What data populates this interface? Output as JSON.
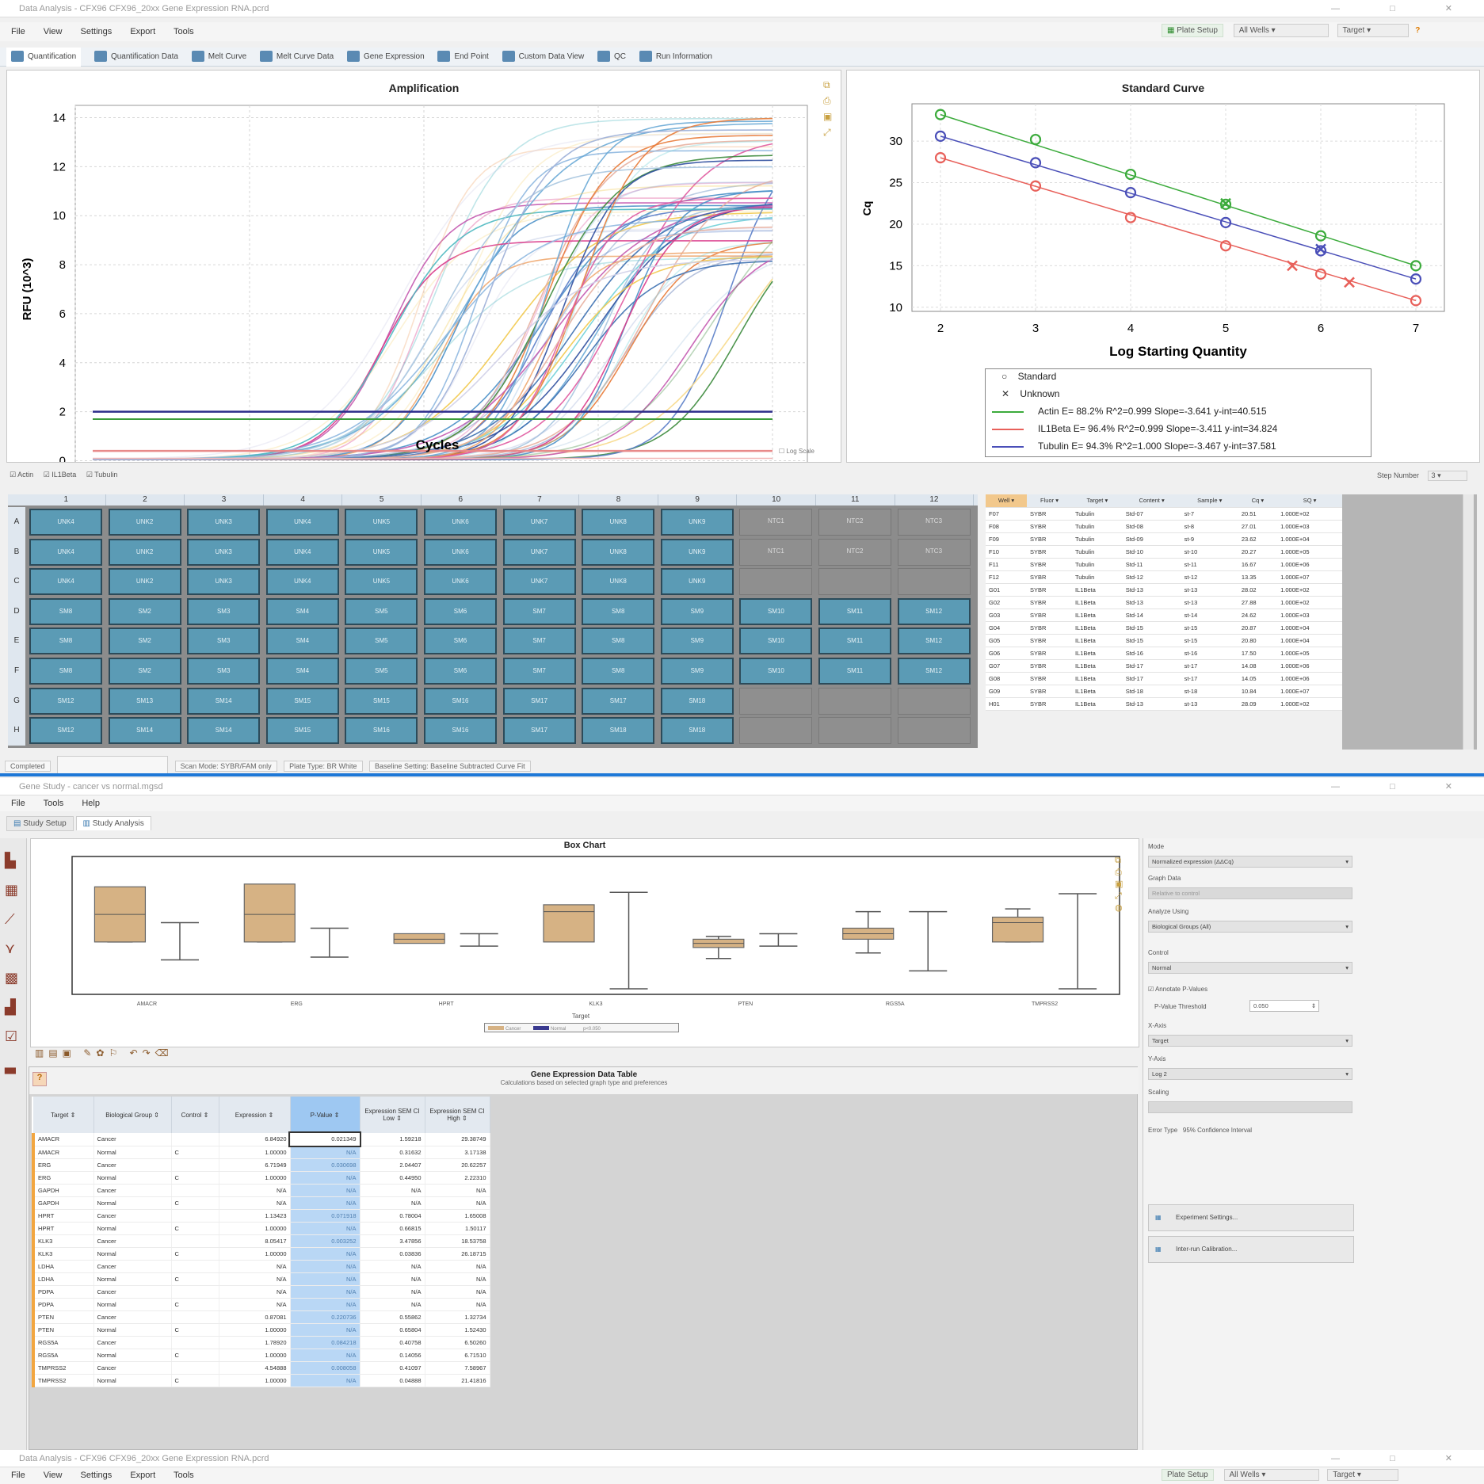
{
  "top_window": {
    "title": "Data Analysis - CFX96 CFX96_20xx Gene Expression RNA.pcrd",
    "menu": [
      "File",
      "View",
      "Settings",
      "Export",
      "Tools"
    ],
    "toolbar_right": {
      "plate_setup": "Plate Setup",
      "well_group": "All Wells",
      "select": "Target"
    },
    "tabs": [
      "Quantification",
      "Quantification Data",
      "Melt Curve",
      "Melt Curve Data",
      "Gene Expression",
      "End Point",
      "Custom Data View",
      "QC",
      "Run Information"
    ],
    "legend_checks": [
      "Actin",
      "IL1Beta",
      "Tubulin"
    ],
    "log_scale": "Log Scale",
    "step_number": "Step Number",
    "step_value": "3"
  },
  "amplification": {
    "title": "Amplification",
    "xlabel": "Cycles",
    "ylabel": "RFU (10^3)",
    "xticks": [
      "0",
      "10",
      "20",
      "30",
      "40"
    ],
    "yticks": [
      "0",
      "2",
      "4",
      "6",
      "8",
      "10",
      "12",
      "14"
    ]
  },
  "standard_curve": {
    "title": "Standard Curve",
    "xlabel": "Log Starting Quantity",
    "ylabel": "Cq",
    "xticks": [
      "2",
      "3",
      "4",
      "5",
      "6",
      "7"
    ],
    "yticks": [
      "10",
      "15",
      "20",
      "25",
      "30"
    ],
    "legend": {
      "standard": "Standard",
      "unknown": "Unknown",
      "actin": "Actin   E= 88.2% R^2=0.999 Slope=-3.641 y-int=40.515",
      "il1beta": "IL1Beta  E= 96.4% R^2=0.999 Slope=-3.411 y-int=34.824",
      "tubulin": "Tubulin  E= 94.3% R^2=1.000 Slope=-3.467 y-int=37.581"
    }
  },
  "chart_data": [
    {
      "type": "line",
      "title": "Amplification",
      "xlabel": "Cycles",
      "ylabel": "RFU (10^3)",
      "xlim": [
        0,
        42
      ],
      "ylim": [
        -0.5,
        14.5
      ],
      "series_summary": "sigmoidal amplification curves, Cq range 12-38, plateaus 8-14"
    },
    {
      "type": "scatter",
      "title": "Standard Curve",
      "xlabel": "Log Starting Quantity",
      "ylabel": "Cq",
      "xlim": [
        1.7,
        7.3
      ],
      "ylim": [
        9.5,
        34.5
      ],
      "series": [
        {
          "name": "Actin",
          "color": "#3cab3c",
          "x": [
            2,
            3,
            4,
            5,
            6,
            7
          ],
          "y": [
            33.2,
            30.2,
            26.0,
            22.4,
            18.6,
            15.0
          ],
          "unknowns": {
            "x": [
              5.0
            ],
            "y": [
              22.5
            ]
          }
        },
        {
          "name": "IL1Beta",
          "color": "#e8605a",
          "x": [
            2,
            3,
            4,
            5,
            6,
            7
          ],
          "y": [
            28.0,
            24.6,
            20.8,
            17.4,
            14.0,
            10.8
          ],
          "unknowns": {
            "x": [
              5.7,
              6.3
            ],
            "y": [
              15.0,
              13.0
            ]
          }
        },
        {
          "name": "Tubulin",
          "color": "#4a4fb8",
          "x": [
            2,
            3,
            4,
            5,
            6,
            7
          ],
          "y": [
            30.6,
            27.4,
            23.8,
            20.2,
            16.8,
            13.4
          ],
          "unknowns": {
            "x": [
              6.0
            ],
            "y": [
              17.0
            ]
          }
        }
      ]
    },
    {
      "type": "box",
      "title": "Box Chart",
      "xlabel": "Target",
      "categories": [
        "AMACR",
        "ERG",
        "HPRT",
        "KLK3",
        "PTEN",
        "RGS5A",
        "TMPRSS2"
      ]
    }
  ],
  "plate": {
    "cols": [
      "1",
      "2",
      "3",
      "4",
      "5",
      "6",
      "7",
      "8",
      "9",
      "10",
      "11",
      "12"
    ],
    "rows": [
      "A",
      "B",
      "C",
      "D",
      "E",
      "F",
      "G",
      "H"
    ],
    "wells": [
      [
        "UNK4",
        "UNK2",
        "UNK3",
        "UNK4",
        "UNK5",
        "UNK6",
        "UNK7",
        "UNK8",
        "UNK9",
        "NTC1",
        "NTC2",
        "NTC3"
      ],
      [
        "UNK4",
        "UNK2",
        "UNK3",
        "UNK4",
        "UNK5",
        "UNK6",
        "UNK7",
        "UNK8",
        "UNK9",
        "NTC1",
        "NTC2",
        "NTC3"
      ],
      [
        "UNK4",
        "UNK2",
        "UNK3",
        "UNK4",
        "UNK5",
        "UNK6",
        "UNK7",
        "UNK8",
        "UNK9",
        "",
        "",
        ""
      ],
      [
        "SM8",
        "SM2",
        "SM3",
        "SM4",
        "SM5",
        "SM6",
        "SM7",
        "SM8",
        "SM9",
        "SM10",
        "SM11",
        "SM12"
      ],
      [
        "SM8",
        "SM2",
        "SM3",
        "SM4",
        "SM5",
        "SM6",
        "SM7",
        "SM8",
        "SM9",
        "SM10",
        "SM11",
        "SM12"
      ],
      [
        "SM8",
        "SM2",
        "SM3",
        "SM4",
        "SM5",
        "SM6",
        "SM7",
        "SM8",
        "SM9",
        "SM10",
        "SM11",
        "SM12"
      ],
      [
        "SM12",
        "SM13",
        "SM14",
        "SM15",
        "SM15",
        "SM16",
        "SM17",
        "SM17",
        "SM18",
        "",
        "",
        ""
      ],
      [
        "SM12",
        "SM14",
        "SM14",
        "SM15",
        "SM16",
        "SM16",
        "SM17",
        "SM18",
        "SM18",
        "",
        "",
        ""
      ]
    ]
  },
  "results_table": {
    "headers": [
      "Well",
      "Fluor",
      "Target",
      "Content",
      "Sample",
      "Cq",
      "SQ"
    ],
    "rows": [
      [
        "F07",
        "SYBR",
        "Tubulin",
        "Std-07",
        "st-7",
        "20.51",
        "1.000E+02"
      ],
      [
        "F08",
        "SYBR",
        "Tubulin",
        "Std-08",
        "st-8",
        "27.01",
        "1.000E+03"
      ],
      [
        "F09",
        "SYBR",
        "Tubulin",
        "Std-09",
        "st-9",
        "23.62",
        "1.000E+04"
      ],
      [
        "F10",
        "SYBR",
        "Tubulin",
        "Std-10",
        "st-10",
        "20.27",
        "1.000E+05"
      ],
      [
        "F11",
        "SYBR",
        "Tubulin",
        "Std-11",
        "st-11",
        "16.67",
        "1.000E+06"
      ],
      [
        "F12",
        "SYBR",
        "Tubulin",
        "Std-12",
        "st-12",
        "13.35",
        "1.000E+07"
      ],
      [
        "G01",
        "SYBR",
        "IL1Beta",
        "Std-13",
        "st-13",
        "28.02",
        "1.000E+02"
      ],
      [
        "G02",
        "SYBR",
        "IL1Beta",
        "Std-13",
        "st-13",
        "27.88",
        "1.000E+02"
      ],
      [
        "G03",
        "SYBR",
        "IL1Beta",
        "Std-14",
        "st-14",
        "24.62",
        "1.000E+03"
      ],
      [
        "G04",
        "SYBR",
        "IL1Beta",
        "Std-15",
        "st-15",
        "20.87",
        "1.000E+04"
      ],
      [
        "G05",
        "SYBR",
        "IL1Beta",
        "Std-15",
        "st-15",
        "20.80",
        "1.000E+04"
      ],
      [
        "G06",
        "SYBR",
        "IL1Beta",
        "Std-16",
        "st-16",
        "17.50",
        "1.000E+05"
      ],
      [
        "G07",
        "SYBR",
        "IL1Beta",
        "Std-17",
        "st-17",
        "14.08",
        "1.000E+06"
      ],
      [
        "G08",
        "SYBR",
        "IL1Beta",
        "Std-17",
        "st-17",
        "14.05",
        "1.000E+06"
      ],
      [
        "G09",
        "SYBR",
        "IL1Beta",
        "Std-18",
        "st-18",
        "10.84",
        "1.000E+07"
      ],
      [
        "H01",
        "SYBR",
        "IL1Beta",
        "Std-13",
        "st-13",
        "28.09",
        "1.000E+02"
      ]
    ]
  },
  "status": [
    "Completed",
    "Scan Mode: SYBR/FAM only",
    "Plate Type: BR White",
    "Baseline Setting: Baseline Subtracted Curve Fit"
  ],
  "study_window": {
    "title": "Gene Study - cancer vs normal.mgsd",
    "menu": [
      "File",
      "Tools",
      "Help"
    ],
    "tabs": [
      "Study Setup",
      "Study Analysis"
    ],
    "box_title": "Box Chart",
    "box_xlabel": "Target",
    "box_legend": [
      "Cancer",
      "Normal",
      "p<0.050"
    ],
    "table_title": "Gene Expression Data Table",
    "table_subtitle": "Calculations based on selected graph type and preferences",
    "headers": [
      "Target",
      "Biological Group",
      "Control",
      "Expression",
      "P-Value",
      "Expression SEM CI Low",
      "Expression SEM CI High"
    ],
    "rows": [
      [
        "AMACR",
        "Cancer",
        "",
        "6.84920",
        "0.021349",
        "1.59218",
        "29.38749"
      ],
      [
        "AMACR",
        "Normal",
        "C",
        "1.00000",
        "N/A",
        "0.31632",
        "3.17138"
      ],
      [
        "ERG",
        "Cancer",
        "",
        "6.71949",
        "0.030698",
        "2.04407",
        "20.62257"
      ],
      [
        "ERG",
        "Normal",
        "C",
        "1.00000",
        "N/A",
        "0.44950",
        "2.22310"
      ],
      [
        "GAPDH",
        "Cancer",
        "",
        "N/A",
        "N/A",
        "N/A",
        "N/A"
      ],
      [
        "GAPDH",
        "Normal",
        "C",
        "N/A",
        "N/A",
        "N/A",
        "N/A"
      ],
      [
        "HPRT",
        "Cancer",
        "",
        "1.13423",
        "0.071918",
        "0.78004",
        "1.65008"
      ],
      [
        "HPRT",
        "Normal",
        "C",
        "1.00000",
        "N/A",
        "0.66815",
        "1.50117"
      ],
      [
        "KLK3",
        "Cancer",
        "",
        "8.05417",
        "0.003252",
        "3.47856",
        "18.53758"
      ],
      [
        "KLK3",
        "Normal",
        "C",
        "1.00000",
        "N/A",
        "0.03836",
        "26.18715"
      ],
      [
        "LDHA",
        "Cancer",
        "",
        "N/A",
        "N/A",
        "N/A",
        "N/A"
      ],
      [
        "LDHA",
        "Normal",
        "C",
        "N/A",
        "N/A",
        "N/A",
        "N/A"
      ],
      [
        "PDPA",
        "Cancer",
        "",
        "N/A",
        "N/A",
        "N/A",
        "N/A"
      ],
      [
        "PDPA",
        "Normal",
        "C",
        "N/A",
        "N/A",
        "N/A",
        "N/A"
      ],
      [
        "PTEN",
        "Cancer",
        "",
        "0.87081",
        "0.220736",
        "0.55862",
        "1.32734"
      ],
      [
        "PTEN",
        "Normal",
        "C",
        "1.00000",
        "N/A",
        "0.65804",
        "1.52430"
      ],
      [
        "RGS5A",
        "Cancer",
        "",
        "1.78920",
        "0.084218",
        "0.40758",
        "6.50260"
      ],
      [
        "RGS5A",
        "Normal",
        "C",
        "1.00000",
        "N/A",
        "0.14056",
        "6.71510"
      ],
      [
        "TMPRSS2",
        "Cancer",
        "",
        "4.54888",
        "0.008058",
        "0.41097",
        "7.58967"
      ],
      [
        "TMPRSS2",
        "Normal",
        "C",
        "1.00000",
        "N/A",
        "0.04888",
        "21.41816"
      ]
    ],
    "side": {
      "mode_label": "Mode",
      "mode_value": "Normalized expression (ΔΔCq)",
      "graph_data_label": "Graph Data",
      "graph_data_value": "Relative to control",
      "analyze_label": "Analyze Using",
      "analyze_value": "Biological Groups (All)",
      "control_label": "Control",
      "control_value": "Normal",
      "annotate": "Annotate P-Values",
      "threshold_label": "P-Value Threshold",
      "threshold_value": "0.050",
      "xaxis_label": "X-Axis",
      "xaxis_value": "Target",
      "yaxis_label": "Y-Axis",
      "yaxis_value": "Log 2",
      "scaling_label": "Scaling",
      "error_label": "Error Type",
      "error_value": "95% Confidence Interval",
      "btn_experiment": "Experiment Settings...",
      "btn_interrun": "Inter-run Calibration..."
    }
  },
  "bottom_window": {
    "title": "Data Analysis - CFX96 CFX96_20xx Gene Expression RNA.pcrd",
    "menu": [
      "File",
      "View",
      "Settings",
      "Export",
      "Tools"
    ],
    "plate_setup": "Plate Setup",
    "well_group": "All Wells",
    "select": "Target"
  }
}
